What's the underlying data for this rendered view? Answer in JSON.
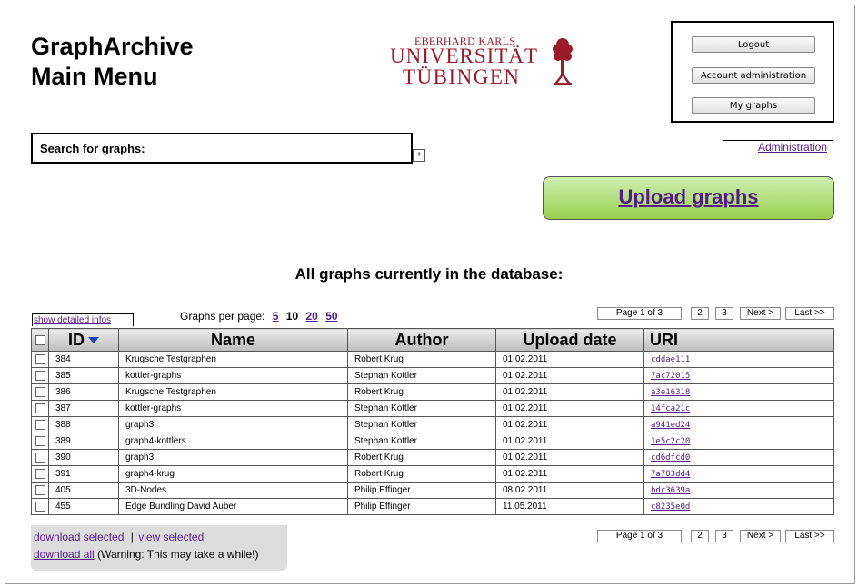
{
  "header": {
    "title_line1": "GraphArchive",
    "title_line2": "Main Menu"
  },
  "logo": {
    "line1": "EBERHARD KARLS",
    "line2": "UNIVERSITÄT",
    "line3": "TÜBINGEN",
    "color": "#9b1b2a"
  },
  "account": {
    "logout": "Logout",
    "account_admin": "Account administration",
    "my_graphs": "My graphs"
  },
  "search": {
    "label": "Search for graphs:",
    "toggle": "+"
  },
  "admin_link": "Administration",
  "upload": {
    "label": "Upload graphs",
    "color": "#98d14e"
  },
  "main_heading": "All graphs currently in the database:",
  "controls": {
    "show_detailed": "show detailed infos",
    "per_page_label": "Graphs per page:",
    "per_page_options": [
      "5",
      "10",
      "20",
      "50"
    ],
    "per_page_selected": "10"
  },
  "pagination": {
    "current": "Page 1 of 3",
    "pages": [
      "2",
      "3"
    ],
    "next": "Next >",
    "last": "Last >>"
  },
  "table": {
    "columns": [
      "ID",
      "Name",
      "Author",
      "Upload date",
      "URI"
    ],
    "rows": [
      {
        "id": "384",
        "name": "Krugsche Testgraphen",
        "author": "Robert Krug",
        "date": "01.02.2011",
        "uri": "cddae111"
      },
      {
        "id": "385",
        "name": "kottler-graphs",
        "author": "Stephan Kottler",
        "date": "01.02.2011",
        "uri": "7ac72015"
      },
      {
        "id": "386",
        "name": "Krugsche Testgraphen",
        "author": "Robert Krug",
        "date": "01.02.2011",
        "uri": "a3e16318"
      },
      {
        "id": "387",
        "name": "kottler-graphs",
        "author": "Stephan Kottler",
        "date": "01.02.2011",
        "uri": "14fca21c"
      },
      {
        "id": "388",
        "name": "graph3",
        "author": "Stephan Kottler",
        "date": "01.02.2011",
        "uri": "a941ed24"
      },
      {
        "id": "389",
        "name": "graph4-kottlers",
        "author": "Stephan Kottler",
        "date": "01.02.2011",
        "uri": "1e5c2c20"
      },
      {
        "id": "390",
        "name": "graph3",
        "author": "Robert Krug",
        "date": "01.02.2011",
        "uri": "cd6dfcd0"
      },
      {
        "id": "391",
        "name": "graph4-krug",
        "author": "Robert Krug",
        "date": "01.02.2011",
        "uri": "7a703dd4"
      },
      {
        "id": "405",
        "name": "3D-Nodes",
        "author": "Philip Effinger",
        "date": "08.02.2011",
        "uri": "bdc3639a"
      },
      {
        "id": "455",
        "name": "Edge Bundling David Auber",
        "author": "Philip Effinger",
        "date": "11.05.2011",
        "uri": "c8235e0d"
      }
    ]
  },
  "footer": {
    "download_selected": "download selected",
    "separator": "|",
    "view_selected": "view selected",
    "download_all": "download all",
    "warning": "(Warning: This may take a while!)"
  }
}
